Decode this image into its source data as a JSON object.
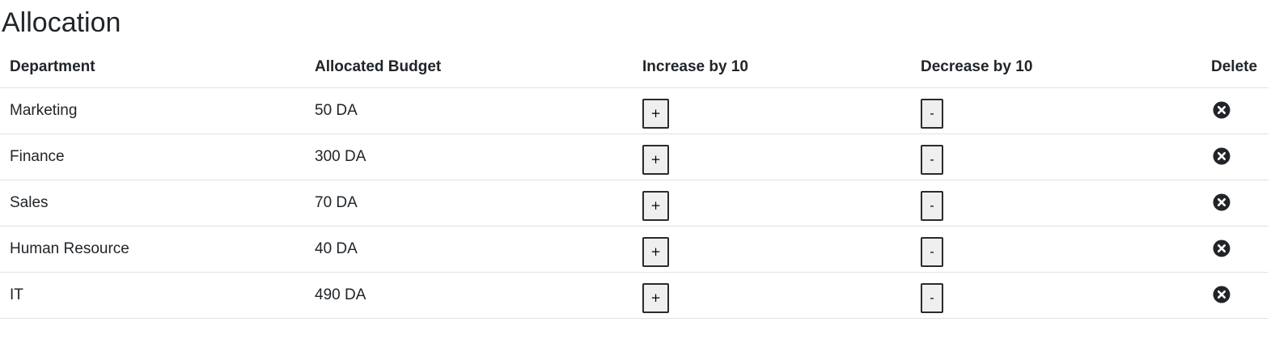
{
  "title": "Allocation",
  "columns": {
    "department": "Department",
    "budget": "Allocated Budget",
    "increase": "Increase by 10",
    "decrease": "Decrease by 10",
    "delete": "Delete"
  },
  "buttons": {
    "increase_label": "+",
    "decrease_label": "-",
    "delete_icon": "close-circle-icon"
  },
  "rows": [
    {
      "department": "Marketing",
      "budget": "50 DA"
    },
    {
      "department": "Finance",
      "budget": "300 DA"
    },
    {
      "department": "Sales",
      "budget": "70 DA"
    },
    {
      "department": "Human Resource",
      "budget": "40 DA"
    },
    {
      "department": "IT",
      "budget": "490 DA"
    }
  ]
}
